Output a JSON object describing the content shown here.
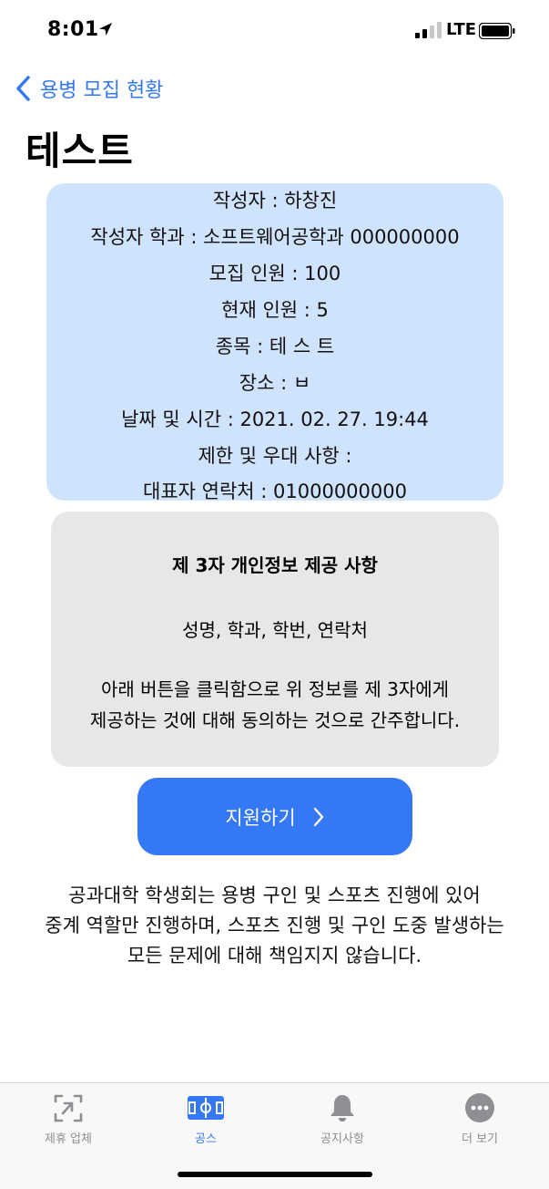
{
  "status_bar": {
    "time": "8:01",
    "network": "LTE"
  },
  "nav": {
    "back_label": "용병 모집 현황"
  },
  "page": {
    "title": "테스트"
  },
  "info": {
    "author": "작성자 : 하창진",
    "department": "작성자 학과 : 소프트웨어공학과 000000000",
    "recruit_count": "모집 인원 : 100",
    "current_count": "현재 인원 : 5",
    "sport": "종목 : 테 스 트",
    "place": "장소 : ㅂ",
    "datetime": "날짜 및 시간 : 2021. 02. 27. 19:44",
    "restrictions": "제한 및 우대 사항 :",
    "contact": "대표자 연락처 : 01000000000"
  },
  "consent": {
    "title": "제 3자 개인정보 제공 사항",
    "items": "성명, 학과, 학번, 연락처",
    "notice_line1": "아래 버튼을 클릭함으로 위 정보를 제 3자에게",
    "notice_line2": "제공하는 것에 대해 동의하는 것으로 간주합니다."
  },
  "apply_button": {
    "label": "지원하기"
  },
  "disclaimer": {
    "line1": "공과대학 학생회는 용병 구인 및 스포츠 진행에 있어",
    "line2": "중계 역할만 진행하며, 스포츠 진행 및 구인 도중 발생하는",
    "line3": "모든 문제에 대해 책임지지 않습니다."
  },
  "tabs": [
    {
      "label": "제휴 업체",
      "icon": "partner-scan-icon",
      "active": false
    },
    {
      "label": "공스",
      "icon": "sports-field-icon",
      "active": true
    },
    {
      "label": "공지사항",
      "icon": "bell-icon",
      "active": false
    },
    {
      "label": "더 보기",
      "icon": "more-ellipsis-icon",
      "active": false
    }
  ],
  "colors": {
    "accent": "#3478f6",
    "info_card_bg": "#d0e3fc",
    "consent_card_bg": "#e7e7e9",
    "tab_inactive": "#8e8e93"
  }
}
